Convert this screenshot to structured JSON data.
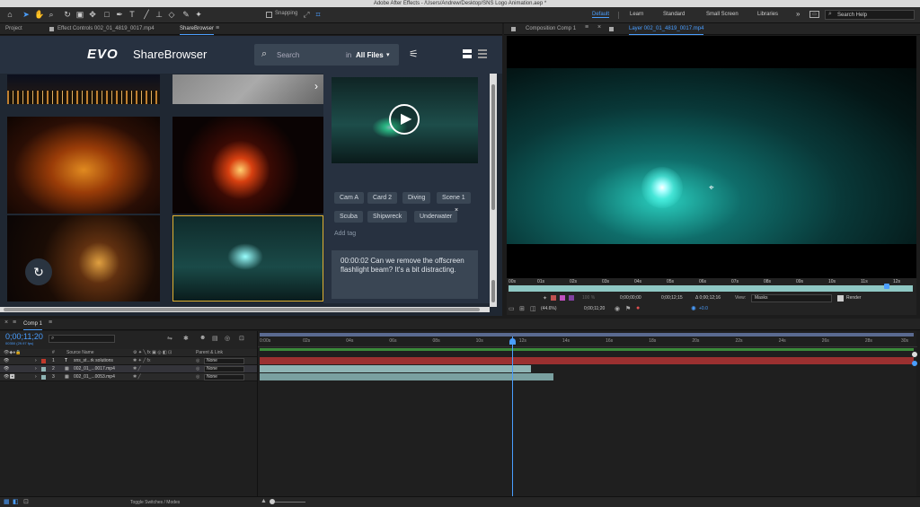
{
  "app_title": "Adobe After Effects - /Users/Andrew/Desktop/SNS Logo Animation.aep *",
  "toolbar": {
    "snapping_label": "Snapping",
    "workspaces": [
      "Default",
      "Learn",
      "Standard",
      "Small Screen",
      "Libraries"
    ],
    "search_help_placeholder": "Search Help"
  },
  "left_tabs": [
    "Project",
    "Effect Controls 002_01_4819_0017.mp4",
    "ShareBrowser"
  ],
  "right_tabs": [
    "Composition Comp 1",
    "Layer 002_01_4819_0017.mp4"
  ],
  "sharebrowser": {
    "brand_mark": "EVO",
    "brand_name": "ShareBrowser",
    "search_placeholder": "Search",
    "search_scope_prefix": "in",
    "search_scope": "All Files",
    "tags": [
      "Cam A",
      "Card 2",
      "Diving",
      "Scene 1",
      "Scuba",
      "Shipwreck",
      "Underwater"
    ],
    "add_tag": "Add tag",
    "comment": "00:00:02 Can we remove the offscreen flashlight beam? It's a bit distracting."
  },
  "layer_viewer": {
    "ruler": [
      "00s",
      "01s",
      "02s",
      "03s",
      "04s",
      "05s",
      "06s",
      "07s",
      "08s",
      "09s",
      "10s",
      "11s",
      "12s"
    ],
    "timecodes": [
      "0;00;00;00",
      "0;00;12;15",
      "Δ 0;00;12;16"
    ],
    "view_label": "View:",
    "view_value": "Masks",
    "render_label": "Render",
    "zoom": "(44.6%)",
    "current_time": "0;00;11;20",
    "exposure": "+0.0",
    "opacity": "100 %"
  },
  "timeline": {
    "comp_tab": "Comp 1",
    "timecode": "0;00;11;20",
    "timecode_sub": "00350 (29.97 fps)",
    "columns": {
      "num": "#",
      "source": "Source Name",
      "parent": "Parent & Link"
    },
    "layers": [
      {
        "num": "1",
        "name": "sns_st...rk solutions",
        "parent": "None",
        "color": "#c0392b"
      },
      {
        "num": "2",
        "name": "002_01_...0017.mp4",
        "parent": "None",
        "color": "#8fb4b4"
      },
      {
        "num": "3",
        "name": "002_01_...0053.mp4",
        "parent": "None",
        "color": "#8fb4b4"
      }
    ],
    "ruler": [
      "0:00s",
      "02s",
      "04s",
      "06s",
      "08s",
      "10s",
      "12s",
      "14s",
      "16s",
      "18s",
      "20s",
      "22s",
      "24s",
      "26s",
      "28s",
      "30s"
    ],
    "toggle_label": "Toggle Switches / Modes"
  }
}
